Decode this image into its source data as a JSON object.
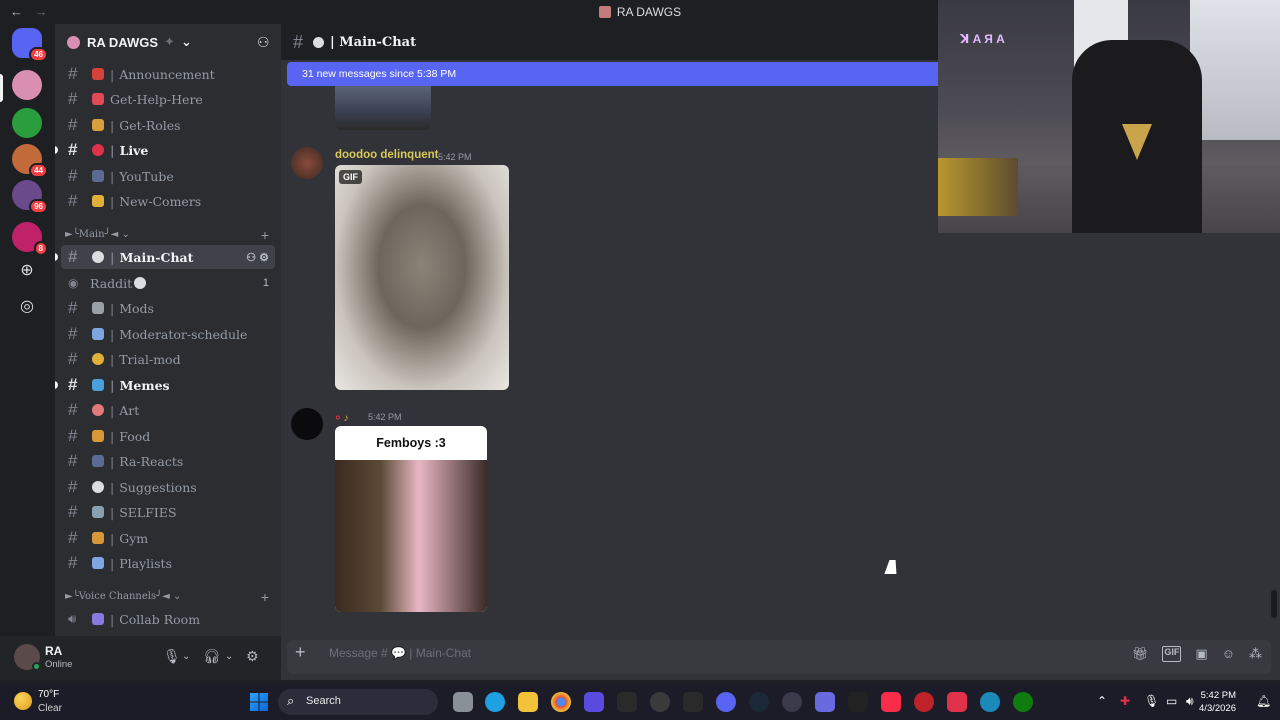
{
  "titlebar": {
    "title": "RA DAWGS",
    "back": "←",
    "forward": "→"
  },
  "guilds": {
    "badges": [
      "46",
      "44",
      "96",
      "8"
    ]
  },
  "server": {
    "name": "RA DAWGS",
    "chevron": "⌄"
  },
  "channels": [
    {
      "name": "Announcement",
      "emoji_color": "#d4423a"
    },
    {
      "name": "Get-Help-Here",
      "emoji_color": "#e04a56"
    },
    {
      "name": "Get-Roles",
      "emoji_color": "#d8a03a"
    },
    {
      "name": "Live",
      "emoji_color": "#e0314a"
    },
    {
      "name": "YouTube",
      "emoji_color": "#5b6b94"
    },
    {
      "name": "New-Comers",
      "emoji_color": "#e0b03a"
    }
  ],
  "categories": {
    "main": "►╰Main╯◄",
    "voice": "►╰Voice Channels╯◄"
  },
  "channels_main": [
    {
      "name": "Main-Chat",
      "emoji_color": "#dbdee1"
    },
    {
      "name": "Raddit",
      "emoji_color": "#dbdee1",
      "count": "1"
    },
    {
      "name": "Mods",
      "emoji_color": "#9aa0a8"
    },
    {
      "name": "Moderator-schedule",
      "emoji_color": "#7ea6e0"
    },
    {
      "name": "Trial-mod",
      "emoji_color": "#e0b03a"
    },
    {
      "name": "Memes",
      "emoji_color": "#4aa0d8"
    },
    {
      "name": "Art",
      "emoji_color": "#e07a7a"
    },
    {
      "name": "Food",
      "emoji_color": "#d8983a"
    },
    {
      "name": "Ra-Reacts",
      "emoji_color": "#5b6b94"
    },
    {
      "name": "Suggestions",
      "emoji_color": "#dbdee1"
    },
    {
      "name": "SELFIES",
      "emoji_color": "#8aa0b0"
    },
    {
      "name": "Gym",
      "emoji_color": "#d8983a"
    },
    {
      "name": "Playlists",
      "emoji_color": "#7ea6e0"
    }
  ],
  "voice_channels": [
    {
      "name": "Collab Room",
      "emoji_color": "#8a7ae0"
    }
  ],
  "user": {
    "name": "RA",
    "status": "Online"
  },
  "chat": {
    "channel_name": "| Main-Chat",
    "new_messages": "31 new messages since 5:38 PM",
    "messages": [
      {
        "author": "doodoo delinquent",
        "time": "5:42 PM",
        "author_color": "#d8c85a",
        "gif_tag": "GIF"
      },
      {
        "author": "",
        "time": "5:42 PM",
        "author_color": "#e0314a",
        "caption": "Femboys :3"
      }
    ]
  },
  "composer": {
    "placeholder": "Message # 💬 | Main-Chat"
  },
  "webcam": {
    "neon_text": "ꓘ A Я A"
  },
  "taskbar": {
    "temp": "70°F",
    "condition": "Clear",
    "search": "Search",
    "time": "5:42 PM",
    "date": "4/3/2026"
  }
}
